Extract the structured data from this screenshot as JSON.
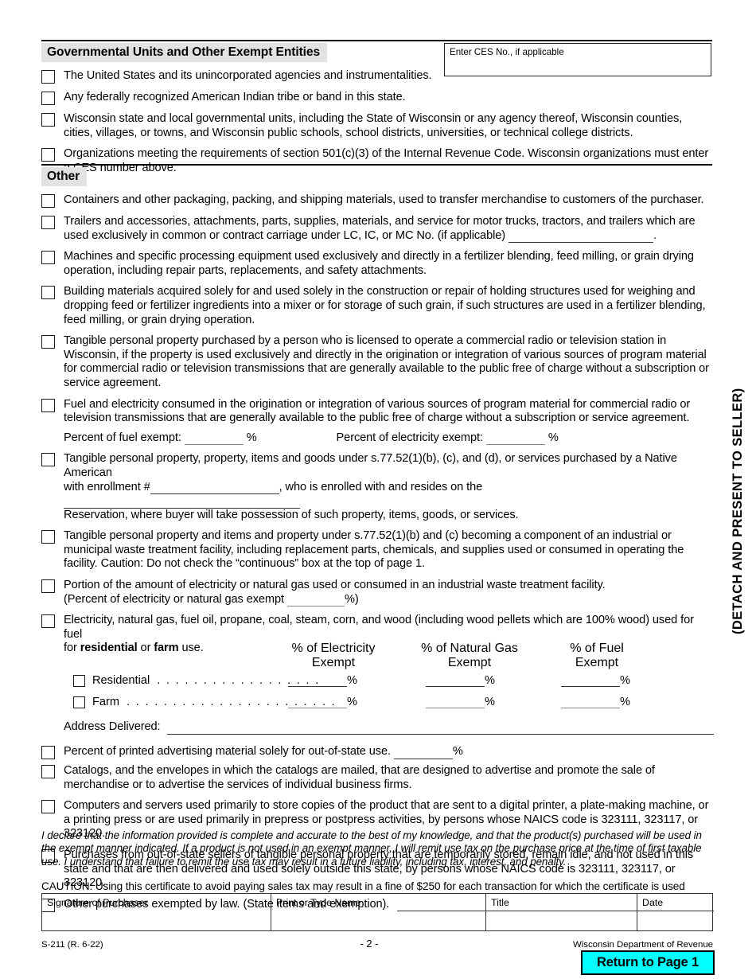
{
  "form": {
    "id": "S-211 (R. 6-22)",
    "page_number": "- 2 -",
    "agency": "Wisconsin Department of Revenue",
    "side_text": "(DETACH AND PRESENT TO SELLER)",
    "return_button": "Return to Page 1"
  },
  "ces": {
    "label": "Enter CES No., if applicable",
    "value": ""
  },
  "sections": {
    "gov": {
      "heading": "Governmental Units and Other Exempt Entities",
      "items": [
        {
          "text": "The United States and its unincorporated agencies and instrumentalities."
        },
        {
          "text": "Any federally recognized American Indian tribe or band in this state."
        },
        {
          "text": "Wisconsin state and local governmental units, including the State of Wisconsin or any agency thereof, Wisconsin counties, cities, villages, or towns, and Wisconsin public schools, school districts, universities, or technical college districts."
        },
        {
          "text": "Organizations meeting the requirements of section 501(c)(3) of the Internal Revenue Code.  Wisconsin organizations must enter a CES number above."
        }
      ]
    },
    "other": {
      "heading": "Other",
      "items": {
        "containers": "Containers and other packaging, packing, and shipping materials, used to transfer merchandise to customers of the purchaser.",
        "trailers_a": "Trailers and accessories, attachments, parts, supplies, materials, and service for motor trucks, tractors, and trailers which are",
        "trailers_b": "used exclusively in common or contract carriage under LC, IC, or MC No. (if applicable)",
        "trailers_b_end": ".",
        "machines": "Machines and specific processing equipment used exclusively and directly in a fertilizer blending, feed milling, or grain drying operation, including repair parts, replacements, and safety attachments.",
        "building": "Building materials acquired solely for and used solely in the construction or repair of holding structures used for weighing and dropping feed or fertilizer ingredients into a mixer or for storage of such grain, if such structures are used in a fertilizer blending, feed milling, or grain drying operation.",
        "tpp_broadcast": "Tangible personal property purchased by a person who is licensed to operate a commercial radio or television station in Wisconsin, if the property is used exclusively and directly in the origination or integration of various sources of program material for commercial radio or television transmissions that are generally available to the public free of charge without a subscription or service agreement.",
        "fuel_electric": "Fuel and electricity consumed in the origination or integration of various sources of program material for commercial radio or television transmissions that are generally available to the public free of charge without a subscription or service agreement.",
        "percent_fuel_label": "Percent of fuel exempt:",
        "percent_electricity_label": "Percent of electricity exempt:",
        "percent_symbol": "%",
        "native_a": "Tangible personal property, property, items and goods under s.77.52(1)(b), (c), and (d), or services purchased by a Native American",
        "native_b_pre": "with enrollment #",
        "native_b_mid": ", who is enrolled with and resides on the",
        "native_c": "Reservation, where buyer will take possession of such property, items, goods, or services.",
        "waste_facility": "Tangible personal property and items and property under s.77.52(1)(b) and (c) becoming a component of an industrial or municipal waste treatment facility, including replacement parts, chemicals, and supplies used or consumed in operating the facility.  Caution: Do not check the “continuous” box at the top of page 1.",
        "portion_a": "Portion of the amount of electricity or natural gas used or consumed in an industrial waste treatment facility.",
        "portion_b_pre": "(Percent of electricity or natural gas exempt",
        "portion_b_post": "%)",
        "residential_intro_a": "Electricity, natural gas, fuel oil, propane, coal, steam, corn, and wood (including wood pellets which are 100% wood) used for fuel",
        "residential_intro_b_pre": "for ",
        "residential_intro_b_bold1": "residential",
        "residential_intro_b_mid": " or ",
        "residential_intro_b_bold2": "farm",
        "residential_intro_b_post": " use.",
        "address_delivered": "Address Delivered:",
        "printed_advertising": "Percent of printed advertising material solely for out-of-state use.",
        "catalogs": "Catalogs, and the envelopes in which the catalogs are mailed, that are designed to advertise and promote the sale of merchandise or to advertise the services of individual business firms.",
        "computers": "Computers and servers used primarily to store copies of the product that are sent to a digital printer, a plate-making machine, or a printing press or are used primarily in prepress or postpress activities, by persons whose NAICS code is 323111, 323117, or 323120.",
        "out_of_state": "Purchases from out-of-state sellers of tangible personal property that are temporarily stored, remain idle, and not used in this state and that are then delivered and used solely outside this state, by persons whose NAICS code is 323111, 323117, or 323120.",
        "other_law": "Other purchases exempted by law. (State items and exemption)."
      }
    }
  },
  "fuel_table": {
    "columns": [
      {
        "line1": "% of Electricity",
        "line2": "Exempt"
      },
      {
        "line1": "% of Natural Gas",
        "line2": "Exempt"
      },
      {
        "line1": "% of Fuel",
        "line2": "Exempt"
      }
    ],
    "rows": [
      {
        "label": "Residential",
        "dots": ". . . . . . . . . . . . . . . . . .",
        "values": [
          "",
          "",
          ""
        ]
      },
      {
        "label": "Farm",
        "dots": ". . . . . . . . . . . . . . . . . . . . . . .",
        "values": [
          "",
          "",
          ""
        ]
      }
    ],
    "percent_symbol": "%"
  },
  "declaration": {
    "text": "I declare that the information provided is complete and accurate to the best of my knowledge, and that the product(s) purchased will be used in the exempt manner indicated. If a product is not used in an exempt manner, I will remit use tax on the purchase price at the time of first taxable use. I understand that failure to remit the use tax may result in a future liability, including tax, interest, and penalty.",
    "caution": "CAUTION: Using this certificate to avoid paying sales tax may result in a fine of $250 for each transaction for which the certificate is used"
  },
  "signature_table": {
    "cells": [
      {
        "label": "Signature of Purchaser",
        "value": ""
      },
      {
        "label": "Print or Type Name",
        "value": ""
      },
      {
        "label": "Title",
        "value": ""
      },
      {
        "label": "Date",
        "value": ""
      }
    ]
  },
  "colors": {
    "accent": "#00ffff",
    "header_bg": "#e2e2e2",
    "ink": "#000000"
  }
}
